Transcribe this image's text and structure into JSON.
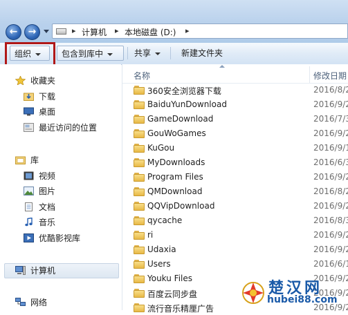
{
  "address": {
    "segments": [
      "计算机",
      "本地磁盘 (D:)"
    ]
  },
  "toolbar": {
    "organize": "组织",
    "include_in_library": "包含到库中",
    "share": "共享",
    "new_folder": "新建文件夹"
  },
  "nav": {
    "favorites": "收藏夹",
    "downloads": "下载",
    "desktop": "桌面",
    "recent": "最近访问的位置",
    "libraries": "库",
    "videos": "视频",
    "pictures": "图片",
    "documents": "文档",
    "music": "音乐",
    "youku": "优酷影视库",
    "computer": "计算机",
    "network": "网络"
  },
  "columns": {
    "name": "名称",
    "modified": "修改日期"
  },
  "files": [
    {
      "name": "360安全浏览器下载",
      "date": "2016/8/2"
    },
    {
      "name": "BaiduYunDownload",
      "date": "2016/9/2"
    },
    {
      "name": "GameDownload",
      "date": "2016/7/3"
    },
    {
      "name": "GouWoGames",
      "date": "2016/9/2"
    },
    {
      "name": "KuGou",
      "date": "2016/9/1"
    },
    {
      "name": "MyDownloads",
      "date": "2016/6/3"
    },
    {
      "name": "Program Files",
      "date": "2016/9/2"
    },
    {
      "name": "QMDownload",
      "date": "2016/8/2"
    },
    {
      "name": "QQVipDownload",
      "date": "2016/9/2"
    },
    {
      "name": "qycache",
      "date": "2016/8/3"
    },
    {
      "name": "ri",
      "date": "2016/9/2"
    },
    {
      "name": "Udaxia",
      "date": "2016/9/2"
    },
    {
      "name": "Users",
      "date": "2016/6/1"
    },
    {
      "name": "Youku Files",
      "date": "2016/9/2"
    },
    {
      "name": "百度云同步盘",
      "date": "2016/9/2"
    },
    {
      "name": "流行音乐精厘广告",
      "date": "2016/9/2"
    }
  ],
  "watermark": {
    "title": "楚汉网",
    "url": "hubei88.com"
  },
  "colors": {
    "highlight": "#b01818",
    "watermark": "#1a5aa8"
  }
}
